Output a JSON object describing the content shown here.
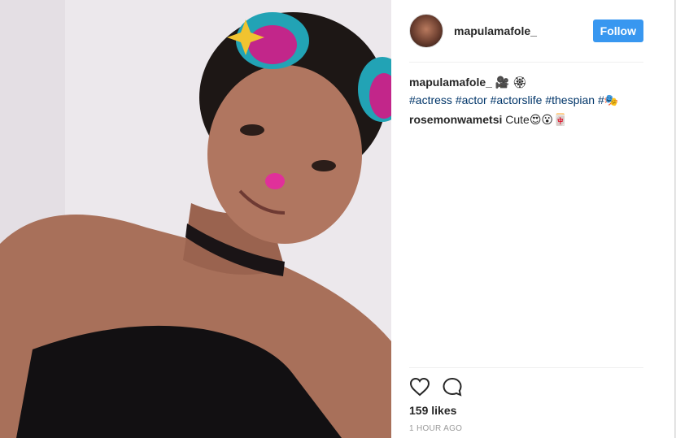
{
  "post": {
    "username": "mapulamafole_",
    "follow_label": "Follow",
    "caption": {
      "username": "mapulamafole_",
      "text": " 🎥 🏵",
      "hashtags": [
        "#actress",
        "#actor",
        "#actorslife",
        "#thespian",
        "#🎭"
      ]
    },
    "comments": [
      {
        "username": "rosemonwametsi",
        "text": "Cute😍😮🀄"
      }
    ],
    "likes": "159 likes",
    "time": "1 HOUR AGO",
    "icons": {
      "like": "heart-icon",
      "comment": "comment-bubble-icon"
    }
  }
}
